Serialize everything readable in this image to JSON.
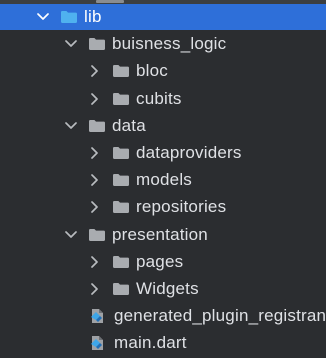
{
  "tree": {
    "rows": [
      {
        "label": "lib",
        "type": "folder",
        "expanded": true,
        "depth": 0,
        "selected": true
      },
      {
        "label": "buisness_logic",
        "type": "folder",
        "expanded": true,
        "depth": 1
      },
      {
        "label": "bloc",
        "type": "folder",
        "expanded": false,
        "depth": 2
      },
      {
        "label": "cubits",
        "type": "folder",
        "expanded": false,
        "depth": 2
      },
      {
        "label": "data",
        "type": "folder",
        "expanded": true,
        "depth": 1
      },
      {
        "label": "dataproviders",
        "type": "folder",
        "expanded": false,
        "depth": 2
      },
      {
        "label": "models",
        "type": "folder",
        "expanded": false,
        "depth": 2
      },
      {
        "label": "repositories",
        "type": "folder",
        "expanded": false,
        "depth": 2
      },
      {
        "label": "presentation",
        "type": "folder",
        "expanded": true,
        "depth": 1
      },
      {
        "label": "pages",
        "type": "folder",
        "expanded": false,
        "depth": 2
      },
      {
        "label": "Widgets",
        "type": "folder",
        "expanded": false,
        "depth": 2
      },
      {
        "label": "generated_plugin_registrant.dart",
        "type": "dart",
        "depth": 2
      },
      {
        "label": "main.dart",
        "type": "dart",
        "depth": 2
      }
    ]
  },
  "colors": {
    "background": "#2b2d30",
    "selection": "#2e6fd9",
    "text": "#dfe1e5",
    "folder": "#a9acb0",
    "folder_source": "#4fb1ef"
  },
  "icons": {
    "expanded": "chevron-down-icon",
    "collapsed": "chevron-right-icon",
    "folder": "folder-icon",
    "dart_file": "dart-file-icon"
  }
}
